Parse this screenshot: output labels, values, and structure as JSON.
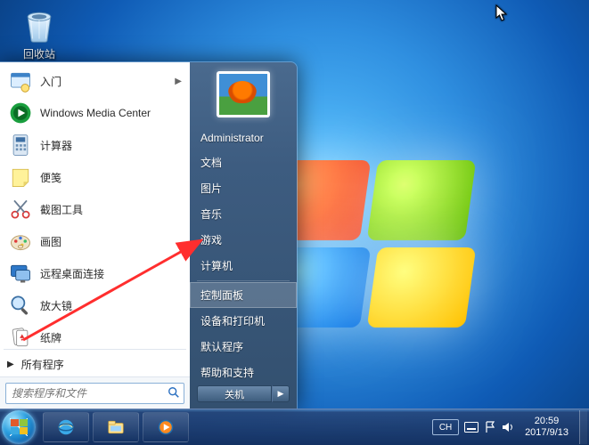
{
  "desktop": {
    "recycle_bin": "回收站"
  },
  "start_menu": {
    "programs": [
      {
        "id": "getting-started",
        "label": "入门",
        "expandable": true,
        "icon": "getting-started"
      },
      {
        "id": "wmc",
        "label": "Windows Media Center",
        "expandable": false,
        "icon": "wmc"
      },
      {
        "id": "calculator",
        "label": "计算器",
        "expandable": false,
        "icon": "calculator"
      },
      {
        "id": "sticky",
        "label": "便笺",
        "expandable": false,
        "icon": "sticky"
      },
      {
        "id": "snip",
        "label": "截图工具",
        "expandable": false,
        "icon": "snip"
      },
      {
        "id": "paint",
        "label": "画图",
        "expandable": false,
        "icon": "paint"
      },
      {
        "id": "rdp",
        "label": "远程桌面连接",
        "expandable": false,
        "icon": "rdp"
      },
      {
        "id": "magnifier",
        "label": "放大镜",
        "expandable": false,
        "icon": "magnifier"
      },
      {
        "id": "solitaire",
        "label": "纸牌",
        "expandable": false,
        "icon": "solitaire"
      }
    ],
    "all_programs": "所有程序",
    "search_placeholder": "搜索程序和文件",
    "user": "Administrator",
    "right_items": [
      {
        "id": "documents",
        "label": "文档"
      },
      {
        "id": "pictures",
        "label": "图片"
      },
      {
        "id": "music",
        "label": "音乐"
      },
      {
        "id": "games",
        "label": "游戏"
      },
      {
        "id": "computer",
        "label": "计算机"
      }
    ],
    "right_items2": [
      {
        "id": "control-panel",
        "label": "控制面板",
        "highlight": true
      },
      {
        "id": "devices",
        "label": "设备和打印机"
      },
      {
        "id": "defaults",
        "label": "默认程序"
      },
      {
        "id": "help",
        "label": "帮助和支持"
      }
    ],
    "shutdown": "关机"
  },
  "taskbar": {
    "lang": "CH",
    "time": "20:59",
    "date": "2017/9/13"
  }
}
